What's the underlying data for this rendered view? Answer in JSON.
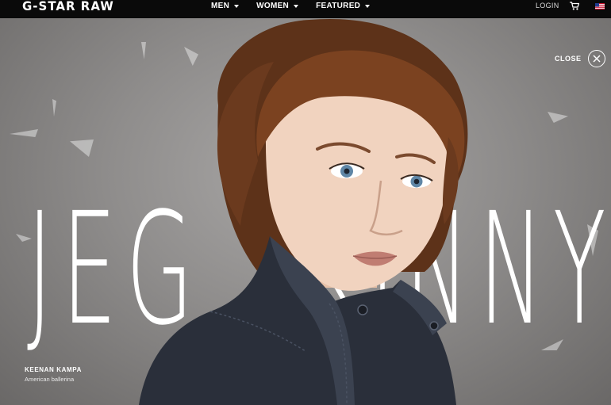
{
  "header": {
    "logo": "G-STAR RAW",
    "nav": [
      {
        "label": "MEN"
      },
      {
        "label": "WOMEN"
      },
      {
        "label": "FEATURED"
      }
    ],
    "login": "LOGIN",
    "cart_icon": "cart-icon",
    "flag_icon": "us-flag-icon"
  },
  "hero": {
    "title": "JEG SKINNY",
    "close_label": "CLOSE",
    "caption": {
      "name": "KEENAN KAMPA",
      "role": "American ballerina"
    }
  },
  "colors": {
    "topbar": "#0a0a0a",
    "background": "#8f8d8c",
    "hair": "#6b3a1e",
    "jacket": "#2a2f3a",
    "skin": "#f1d3bf"
  }
}
